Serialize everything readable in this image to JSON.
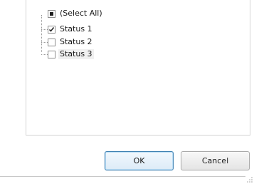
{
  "filter_list": {
    "items": [
      {
        "label": "(Select All)",
        "state": "partial"
      },
      {
        "label": "Status 1",
        "state": "checked"
      },
      {
        "label": "Status 2",
        "state": "unchecked"
      },
      {
        "label": "Status 3",
        "state": "unchecked"
      }
    ]
  },
  "buttons": {
    "ok_label": "OK",
    "cancel_label": "Cancel"
  },
  "colors": {
    "ok_border": "#3c7fb1",
    "border": "#d4d4d4"
  }
}
